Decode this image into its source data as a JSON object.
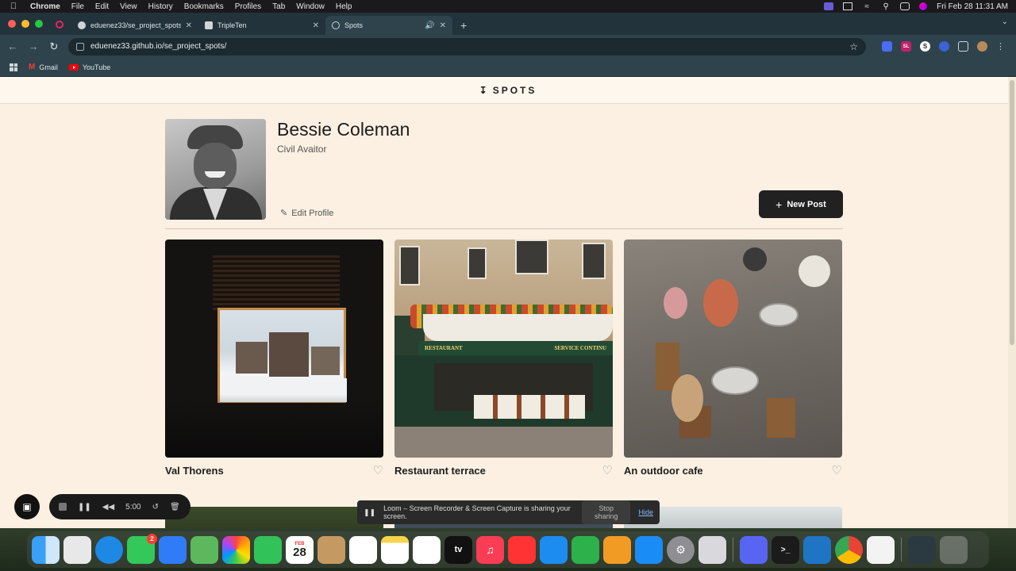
{
  "menubar": {
    "app": "Chrome",
    "items": [
      "File",
      "Edit",
      "View",
      "History",
      "Bookmarks",
      "Profiles",
      "Tab",
      "Window",
      "Help"
    ],
    "datetime": "Fri Feb 28  11:31 AM"
  },
  "browser": {
    "tabs": [
      {
        "title": "eduenez33/se_project_spots"
      },
      {
        "title": "TripleTen"
      },
      {
        "title": "Spots"
      }
    ],
    "url": "eduenez33.github.io/se_project_spots/",
    "bookmarks": [
      "Gmail",
      "YouTube"
    ],
    "extension_labels": {
      "sl": "SL",
      "s": "S"
    }
  },
  "site": {
    "logo": "SPOTS"
  },
  "profile": {
    "name": "Bessie Coleman",
    "description": "Civil Avaitor",
    "edit_label": "Edit Profile",
    "new_post_label": "New Post"
  },
  "cards": [
    {
      "title": "Val Thorens"
    },
    {
      "title": "Restaurant terrace"
    },
    {
      "title": "An outdoor cafe"
    }
  ],
  "card_image_text": {
    "restaurant": "RESTAURANT",
    "service": "SERVICE CONTINU"
  },
  "loom": {
    "timer": "5:00",
    "share_text": "Loom – Screen Recorder & Screen Capture is sharing your screen.",
    "stop_label": "Stop sharing",
    "hide_label": "Hide"
  },
  "dock": {
    "calendar_month": "FEB",
    "calendar_day": "28",
    "messages_badge": "2",
    "appletv_label": "tv"
  },
  "colors": {
    "page_bg": "#fbf0e2",
    "button_dark": "#212121",
    "browser_chrome": "#22333b"
  }
}
